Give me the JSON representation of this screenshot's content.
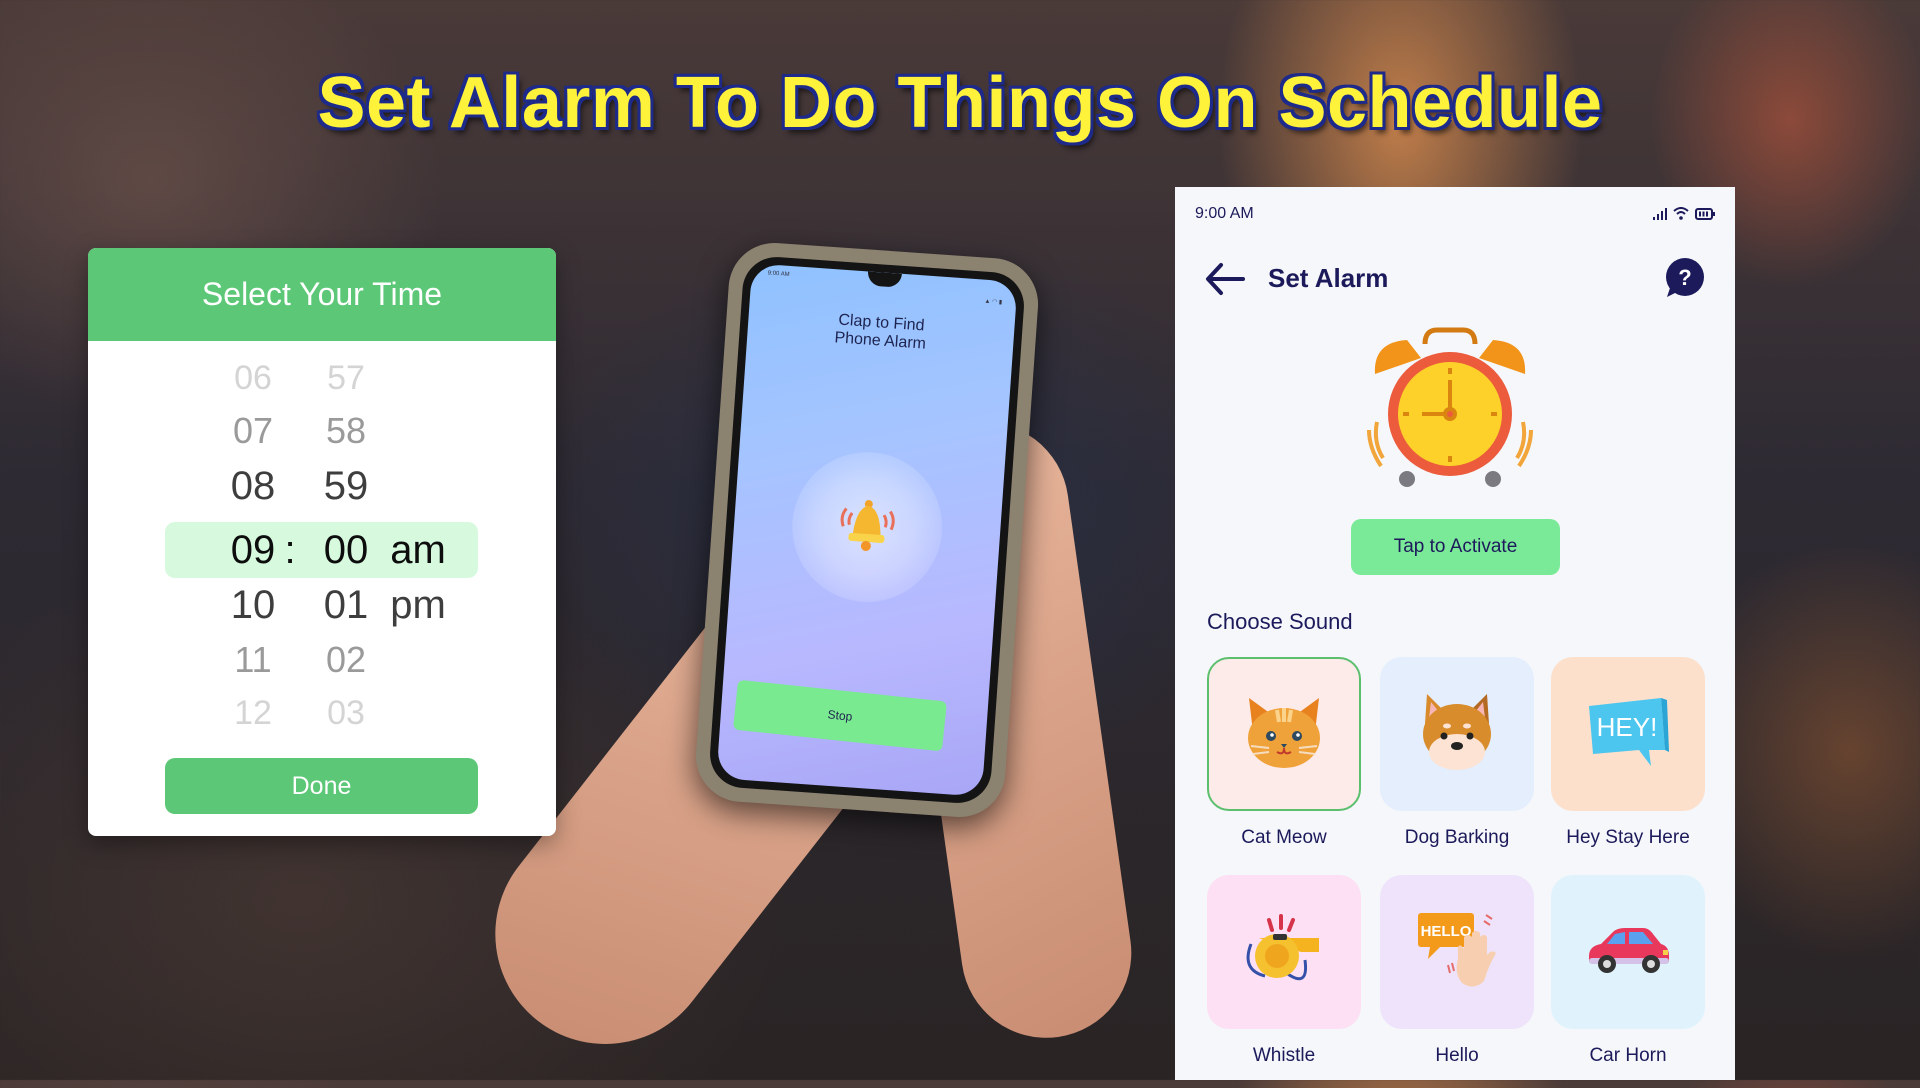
{
  "headline": "Set Alarm To Do Things On Schedule",
  "time_picker": {
    "title": "Select Your Time",
    "rows": [
      {
        "hour": "06",
        "minute": "57",
        "period": "",
        "emphasis": "faint"
      },
      {
        "hour": "07",
        "minute": "58",
        "period": "",
        "emphasis": "mid"
      },
      {
        "hour": "08",
        "minute": "59",
        "period": "",
        "emphasis": "near"
      },
      {
        "hour": "09",
        "minute": "00",
        "period": "am",
        "emphasis": "selected"
      },
      {
        "hour": "10",
        "minute": "01",
        "period": "pm",
        "emphasis": "near"
      },
      {
        "hour": "11",
        "minute": "02",
        "period": "",
        "emphasis": "mid"
      },
      {
        "hour": "12",
        "minute": "03",
        "period": "",
        "emphasis": "faint"
      }
    ],
    "separator": ":",
    "selected_time": "09:00 am",
    "done_label": "Done",
    "colors": {
      "accent": "#5cc877",
      "highlight": "#d7fadf"
    }
  },
  "phone": {
    "status_time": "9:00 AM",
    "title_line1": "Clap to Find",
    "title_line2": "Phone Alarm",
    "icon": "ringing-bell-icon",
    "stop_label": "Stop"
  },
  "app": {
    "status_time": "9:00 AM",
    "status_icons": [
      "signal-icon",
      "wifi-icon",
      "battery-icon"
    ],
    "title": "Set Alarm",
    "back_icon": "arrow-left-icon",
    "help_icon": "help-bubble-icon",
    "hero_icon": "alarm-clock-icon",
    "activate_label": "Tap to Activate",
    "section_title": "Choose Sound",
    "sounds": [
      {
        "label": "Cat Meow",
        "icon": "cat-icon",
        "bg": "#fdebea",
        "selected": true
      },
      {
        "label": "Dog Barking",
        "icon": "dog-icon",
        "bg": "#e4eefd",
        "selected": false
      },
      {
        "label": "Hey Stay Here",
        "icon": "hey-speech-bubble-icon",
        "bg": "#fde0cc",
        "selected": false
      },
      {
        "label": "Whistle",
        "icon": "whistle-icon",
        "bg": "#fde0f3",
        "selected": false
      },
      {
        "label": "Hello",
        "icon": "hello-wave-icon",
        "bg": "#eee3fa",
        "selected": false
      },
      {
        "label": "Car Horn",
        "icon": "car-icon",
        "bg": "#e0f3fd",
        "selected": false
      }
    ],
    "hey_text": "HEY!",
    "hello_text": "HELLO",
    "colors": {
      "primary_text": "#1c1a5b",
      "button": "#7bea98",
      "background": "#f5f7fa"
    }
  }
}
